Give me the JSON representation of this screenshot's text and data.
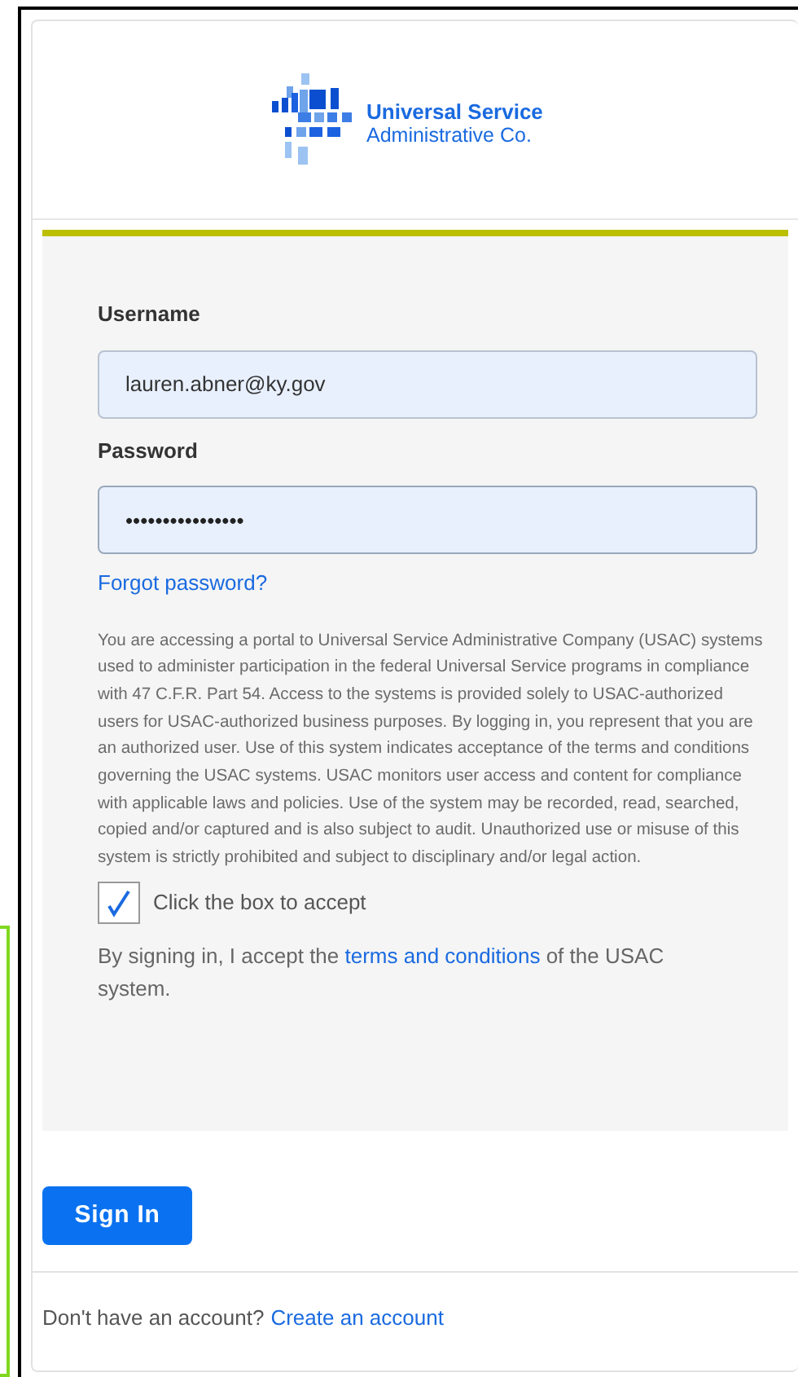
{
  "logo": {
    "line_1": "Universal Service",
    "line_2": "Administrative Co."
  },
  "form": {
    "username_label": "Username",
    "username_value": "lauren.abner@ky.gov",
    "password_label": "Password",
    "password_value": "••••••••••••••••",
    "forgot_link": "Forgot password?",
    "notice": "You are accessing a portal to Universal Service Administrative Company (USAC) systems used to administer participation in the federal Universal Service programs in compliance with 47 C.F.R. Part 54. Access to the systems is provided solely to USAC-authorized users for USAC-authorized business purposes. By logging in, you represent that you are an authorized user. Use of this system indicates acceptance of the terms and conditions governing the USAC systems. USAC monitors user access and content for compliance with applicable laws and policies. Use of the system may be recorded, read, searched, copied and/or captured and is also subject to audit. Unauthorized use or misuse of this system is strictly prohibited and subject to disciplinary and/or legal action.",
    "accept": {
      "label": "Click the box to accept",
      "checked": true
    },
    "terms": {
      "before": "By signing in, I accept the ",
      "link": "terms and conditions",
      "after": " of the USAC system."
    }
  },
  "sign_in_button": "Sign In",
  "footer": {
    "question": "Don't have an account?",
    "link": "Create an account"
  }
}
